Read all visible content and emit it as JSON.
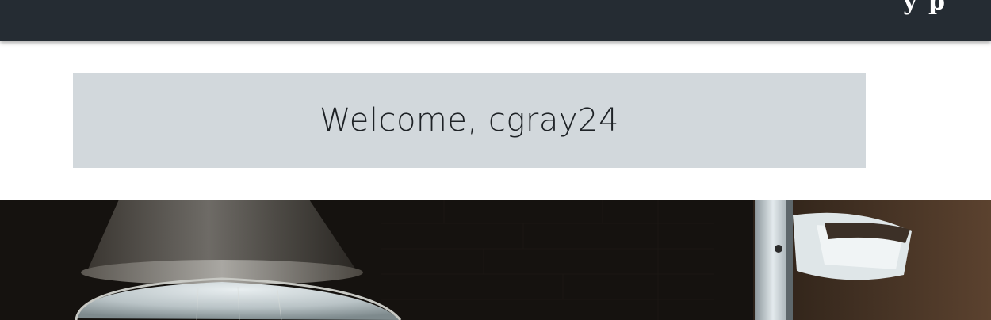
{
  "topbar": {
    "brand_fragment": "y p"
  },
  "welcome": {
    "text": "Welcome, cgray24"
  },
  "hero": {
    "image_subject": "industrial-lamps-photo"
  }
}
